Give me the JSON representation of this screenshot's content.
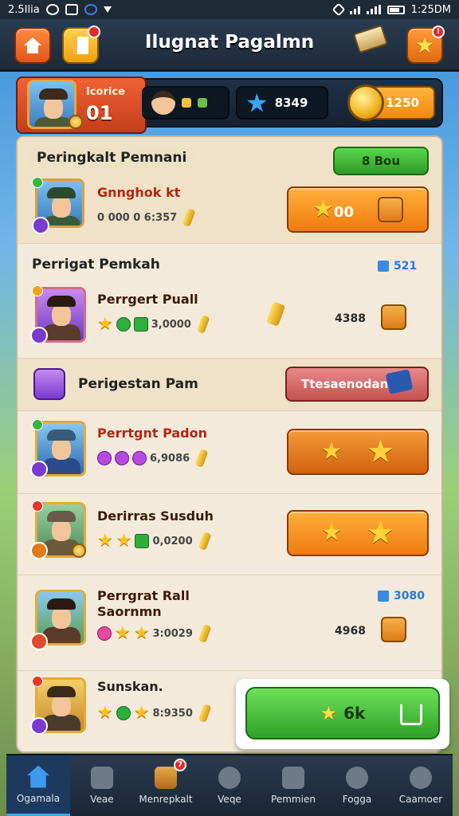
{
  "status_bar": {
    "time_left": "2.5Ilia",
    "time_right": "1:25DM"
  },
  "header": {
    "title": "Ilugnat Pagalmn",
    "notif_badge": "!"
  },
  "profile": {
    "label": "Icorice",
    "value": "01"
  },
  "stats": {
    "resources": "8349",
    "gold": "1250"
  },
  "sections": [
    {
      "title": "Peringkalt Pemnani",
      "action_label": "8 Bou",
      "rows": [
        {
          "name": "Gnnghok kt",
          "meta": "0 000 0 6:357",
          "button_label": "00"
        }
      ]
    },
    {
      "title": "Perrigat Pemkah",
      "badge_value": "521",
      "rows": [
        {
          "name": "Perrgert Puall",
          "meta": "3,0000",
          "count": "4388"
        }
      ]
    },
    {
      "title": "Perigestan Pam",
      "action_label": "Ttesaenodan",
      "rows": [
        {
          "name": "Perrtgnt Padon",
          "meta": "6,9086"
        },
        {
          "name": "Derirras Susduh",
          "meta": "0,0200"
        }
      ]
    },
    {
      "title": "",
      "badge_value": "3080",
      "rows": [
        {
          "name": "Perrgrat Rall",
          "name2": "Saornmn",
          "meta": "3:0029",
          "count": "4968"
        },
        {
          "name": "Sunskan.",
          "meta": "8:9350"
        }
      ]
    }
  ],
  "cta": {
    "label": "6k"
  },
  "nav": [
    {
      "label": "Ogamala",
      "icon": "home-icon"
    },
    {
      "label": "Veae",
      "icon": "cards-icon"
    },
    {
      "label": "Menrepkalt",
      "icon": "chest-icon",
      "badge": "7"
    },
    {
      "label": "Veqe",
      "icon": "shield-icon"
    },
    {
      "label": "Pemmien",
      "icon": "bag-icon"
    },
    {
      "label": "Fogga",
      "icon": "key-icon"
    },
    {
      "label": "Caamoer",
      "icon": "profile-icon"
    }
  ],
  "colors": {
    "accent": "#f07a10",
    "primary_green": "#2e9b28",
    "nav_active": "#3aa6f0"
  }
}
